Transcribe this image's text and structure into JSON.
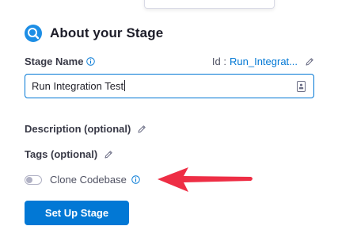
{
  "header": {
    "title": "About your Stage",
    "icon": "stage-search-icon"
  },
  "stage_name": {
    "label": "Stage Name",
    "id_label": "Id :",
    "id_value": "Run_Integrat...",
    "input_value": "Run Integration Test"
  },
  "description": {
    "label": "Description (optional)"
  },
  "tags": {
    "label": "Tags (optional)"
  },
  "clone_codebase": {
    "label": "Clone Codebase",
    "enabled": false
  },
  "actions": {
    "setup_label": "Set Up Stage"
  },
  "colors": {
    "accent": "#0278d5",
    "annotation_arrow": "#ee2e45",
    "text": "#22222a",
    "muted": "#4f5162"
  }
}
